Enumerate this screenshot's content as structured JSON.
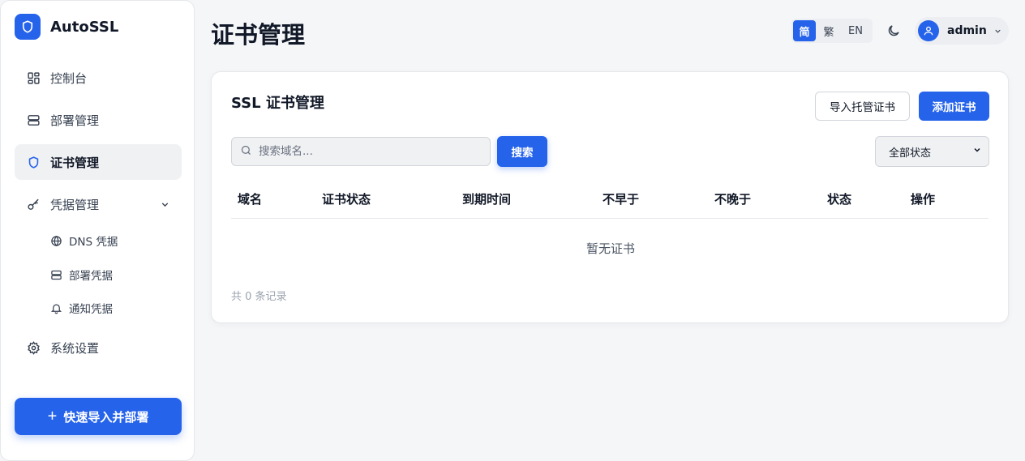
{
  "brand": {
    "name": "AutoSSL",
    "logo_icon": "shield-icon",
    "accent": "#2563eb"
  },
  "sidebar": {
    "items": [
      {
        "label": "控制台",
        "icon": "dashboard-icon"
      },
      {
        "label": "部署管理",
        "icon": "server-icon"
      },
      {
        "label": "证书管理",
        "icon": "shield-icon",
        "active": true
      },
      {
        "label": "凭据管理",
        "icon": "key-icon",
        "expanded": true
      },
      {
        "label": "系统设置",
        "icon": "gear-icon"
      }
    ],
    "subitems": [
      {
        "label": "DNS 凭据",
        "icon": "globe-icon"
      },
      {
        "label": "部署凭据",
        "icon": "server-icon"
      },
      {
        "label": "通知凭据",
        "icon": "bell-icon"
      }
    ],
    "quick_button": "快速导入并部署"
  },
  "header": {
    "title": "证书管理",
    "languages": [
      "简",
      "繁",
      "EN"
    ],
    "active_language": "简",
    "user": "admin"
  },
  "card": {
    "title": "SSL 证书管理",
    "import_button": "导入托管证书",
    "add_button": "添加证书",
    "search_placeholder": "搜索域名...",
    "search_button": "搜索",
    "status_filter": "全部状态",
    "columns": [
      "域名",
      "证书状态",
      "到期时间",
      "不早于",
      "不晚于",
      "状态",
      "操作"
    ],
    "empty_text": "暂无证书",
    "total_text": "共 0 条记录"
  }
}
